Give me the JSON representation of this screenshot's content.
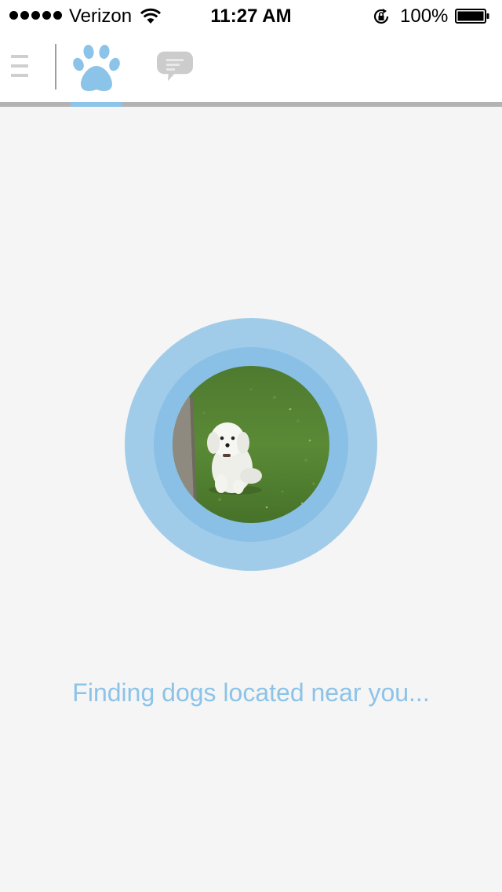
{
  "status_bar": {
    "carrier": "Verizon",
    "time": "11:27 AM",
    "battery_percent": "100%",
    "signal_bars": 5,
    "icons": [
      "signal-dots-icon",
      "wifi-icon",
      "rotation-lock-icon",
      "battery-icon"
    ]
  },
  "nav": {
    "items": [
      {
        "name": "menu",
        "icon": "hamburger-icon"
      },
      {
        "name": "find-dogs",
        "icon": "paw-icon",
        "active": true
      },
      {
        "name": "messages",
        "icon": "chat-bubble-icon"
      }
    ],
    "accent_color": "#8cc3e8",
    "inactive_color": "#cccccc"
  },
  "main": {
    "avatar_alt": "dog-photo",
    "status_message": "Finding dogs located near you..."
  },
  "colors": {
    "background": "#f5f5f5",
    "radar_outer": "#a1cce9",
    "radar_inner": "#8ac0e6",
    "text_accent": "#8cc3e8"
  }
}
